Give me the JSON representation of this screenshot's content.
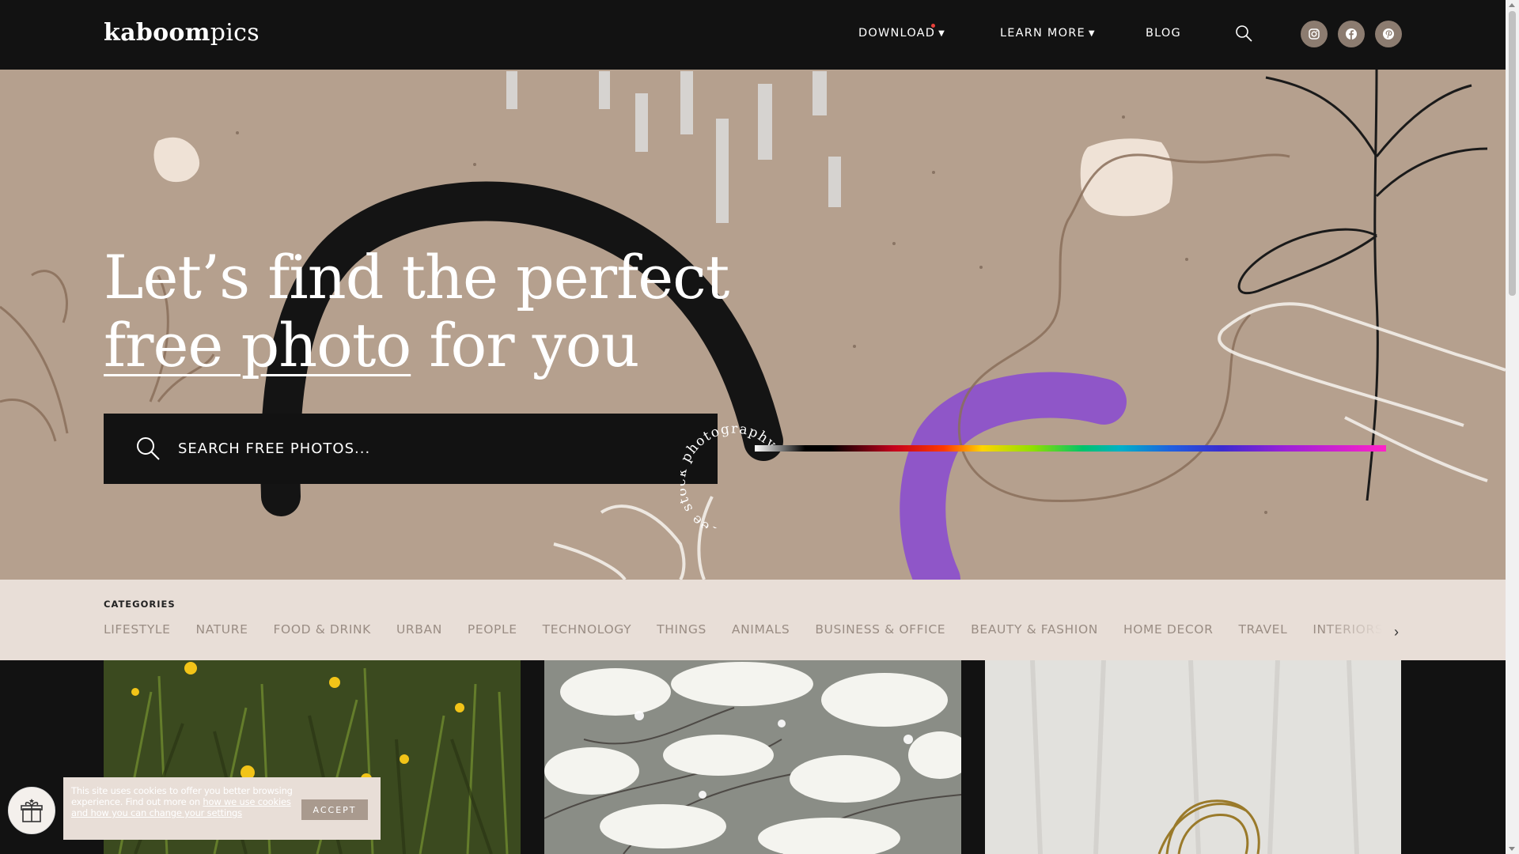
{
  "header": {
    "logo_bold": "kaboom",
    "logo_light": "pics",
    "nav": [
      {
        "label": "DOWNLOAD",
        "icon": "chevron-down-icon"
      },
      {
        "label": "LEARN MORE",
        "icon": "chevron-down-icon"
      },
      {
        "label": "BLOG"
      }
    ],
    "search_icon": "search-icon",
    "social": [
      "instagram-icon",
      "facebook-icon",
      "pinterest-icon"
    ]
  },
  "hero": {
    "title_line1": "Let’s find the perfect",
    "title_underlined": "free photo",
    "title_rest": " for you",
    "search_placeholder": "SEARCH FREE PHOTOS...",
    "circular_text": "free stock photography",
    "background_color": "#b5a08e"
  },
  "categories": {
    "title": "CATEGORIES",
    "items": [
      "LIFESTYLE",
      "NATURE",
      "FOOD & DRINK",
      "URBAN",
      "PEOPLE",
      "TECHNOLOGY",
      "THINGS",
      "ANIMALS",
      "BUSINESS & OFFICE",
      "BEAUTY & FASHION",
      "HOME DECOR",
      "TRAVEL",
      "INTERIORS"
    ],
    "next_icon": "chevron-right-icon"
  },
  "photos": [
    {
      "subject": "grass with yellow dandelions"
    },
    {
      "subject": "white blossom bush"
    },
    {
      "subject": "white cloth with gold ring"
    }
  ],
  "cookie": {
    "text": "This site uses cookies to offer you better browsing experience. Find out more on ",
    "link": "how we use cookies and how you can change your settings",
    "accept_label": "ACCEPT"
  },
  "colors": {
    "header_bg": "#121212",
    "category_bg": "#e8ded7",
    "accent_dot": "#e8403a"
  }
}
